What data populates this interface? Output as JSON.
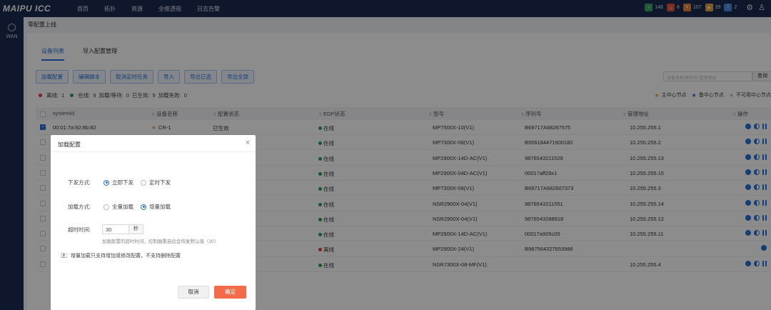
{
  "app": {
    "logo": "MAIPU ICC",
    "nav": [
      "首页",
      "拓扑",
      "资源",
      "全维透视",
      "日志告警"
    ]
  },
  "alerts": [
    {
      "icon": "bell-icon",
      "count": "148",
      "color": "#3fa56a"
    },
    {
      "icon": "fire-icon",
      "count": "8",
      "color": "#e0533d"
    },
    {
      "icon": "lightning-icon",
      "count": "107",
      "color": "#e8833a"
    },
    {
      "icon": "star-icon",
      "count": "39",
      "color": "#e6a23c"
    },
    {
      "icon": "info-icon",
      "count": "2",
      "color": "#4a8be0"
    }
  ],
  "sidebar": {
    "label": "WAN"
  },
  "breadcrumb": "零配置上线",
  "tabs": [
    "设备列表",
    "导入配置管理"
  ],
  "toolbar": [
    "加载配置",
    "编辑脚本",
    "取消定时任务",
    "导入",
    "导出已选",
    "导出全部"
  ],
  "search": {
    "placeholder": "设备名称/序列号/管理地址",
    "button": "查询"
  },
  "status": {
    "offline_label": "离线:",
    "offline": "1",
    "online_label": "在线:",
    "online": "9",
    "loading_label": "加载/等待:",
    "loading": "0",
    "effective_label": "已生效:",
    "effective": "9",
    "failed_label": "加载失败:",
    "failed": "0"
  },
  "legend": {
    "main": "主中心节点",
    "backup": "备中心节点",
    "unavailable": "不可用中心节点"
  },
  "columns": [
    "systemId",
    "设备名称",
    "配置状态",
    "EDP状态",
    "型号",
    "序列号",
    "管理地址",
    "操作"
  ],
  "rows": [
    {
      "systemid": "00:01:7a:92:8b:82",
      "name": "CR-1",
      "config": "已生效",
      "edp": "在线",
      "model": "MP7500X-10(V1)",
      "serial": "B69717A68267575",
      "addr": "10.255.255.1"
    },
    {
      "systemid": "",
      "name": "",
      "config": "",
      "edp": "在线",
      "model": "MP7300X-08(V1)",
      "serial": "B556184471900182",
      "addr": "10.255.255.2"
    },
    {
      "systemid": "",
      "name": "",
      "config": "",
      "edp": "在线",
      "model": "MP2900X-14D-AC(V1)",
      "serial": "9876543211529",
      "addr": "10.255.255.13"
    },
    {
      "systemid": "",
      "name": "",
      "config": "",
      "edp": "在线",
      "model": "MP2900X-04D-AC(V1)",
      "serial": "00017aff29x1",
      "addr": "10.255.255.15"
    },
    {
      "systemid": "",
      "name": "",
      "config": "",
      "edp": "在线",
      "model": "MP7300X-08(V1)",
      "serial": "B69717A682607373",
      "addr": "10.255.255.3"
    },
    {
      "systemid": "",
      "name": "",
      "config": "",
      "edp": "在线",
      "model": "NSR2900X-04(V1)",
      "serial": "9876543211551",
      "addr": "10.255.255.14"
    },
    {
      "systemid": "",
      "name": "",
      "config": "",
      "edp": "在线",
      "model": "NSR2900X-04(V1)",
      "serial": "9876543288818",
      "addr": "10.255.255.12"
    },
    {
      "systemid": "",
      "name": "",
      "config": "",
      "edp": "在线",
      "model": "MP2900X-14D-AC(V1)",
      "serial": "00017a905c05",
      "addr": "10.255.255.11"
    },
    {
      "systemid": "",
      "name": "",
      "config": "",
      "edp": "离线",
      "model": "MP2900X-24(V1)",
      "serial": "B987564327653986",
      "addr": ""
    },
    {
      "systemid": "",
      "name": "",
      "config": "",
      "edp": "在线",
      "model": "NSR7300X-08-MF(V1)",
      "serial": "",
      "addr": "10.255.255.4"
    }
  ],
  "modal": {
    "title": "加载配置",
    "dispatch_label": "下发方式:",
    "dispatch_options": [
      "立即下发",
      "定时下发"
    ],
    "load_label": "加载方式:",
    "load_options": [
      "全量加载",
      "增量加载"
    ],
    "timeout_label": "超时时间:",
    "timeout_value": "30",
    "timeout_unit": "秒",
    "hint": "加载配置的超时时间，控制器重启后会恢复默认值（30）",
    "note": "注：增量加载只支持增加或修改配置，不支持删除配置",
    "cancel": "取消",
    "confirm": "确定"
  }
}
